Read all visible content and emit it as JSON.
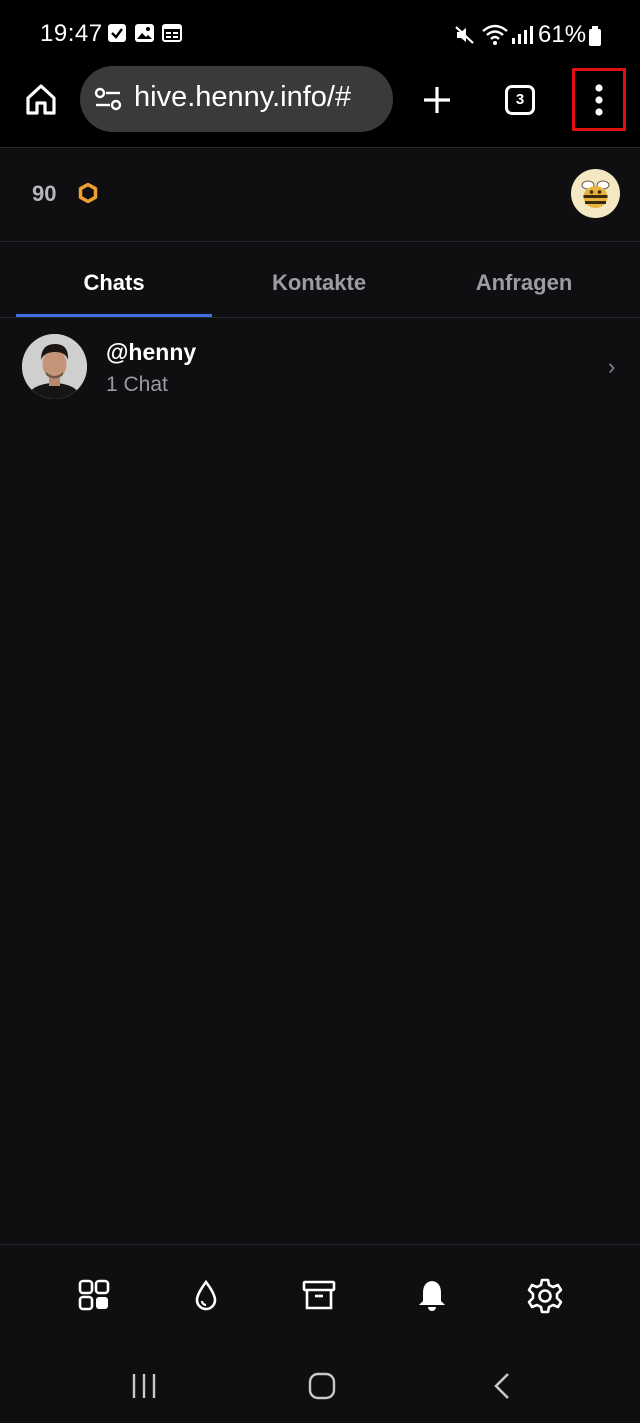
{
  "status_bar": {
    "time": "19:47",
    "battery": "61%"
  },
  "browser": {
    "url": "hive.henny.info/#",
    "tab_count": "3",
    "icons": [
      "home-icon",
      "site-settings-icon",
      "new-tab-icon",
      "tab-switcher-icon",
      "more-vert-icon"
    ]
  },
  "header": {
    "points": "90",
    "points_icon": "hexagon-icon",
    "accent": "#f0a030"
  },
  "tabs": [
    {
      "label": "Chats",
      "active": true
    },
    {
      "label": "Kontakte",
      "active": false
    },
    {
      "label": "Anfragen",
      "active": false
    }
  ],
  "chats": [
    {
      "name": "@henny",
      "subtitle": "1 Chat"
    }
  ],
  "bottom_nav": {
    "items": [
      "apps-grid-icon",
      "drop-icon",
      "archive-icon",
      "bell-icon",
      "gear-icon"
    ]
  },
  "colors": {
    "background": "#0f0f12",
    "tab_indicator": "#3d6fe0",
    "highlight": "#e01010"
  }
}
